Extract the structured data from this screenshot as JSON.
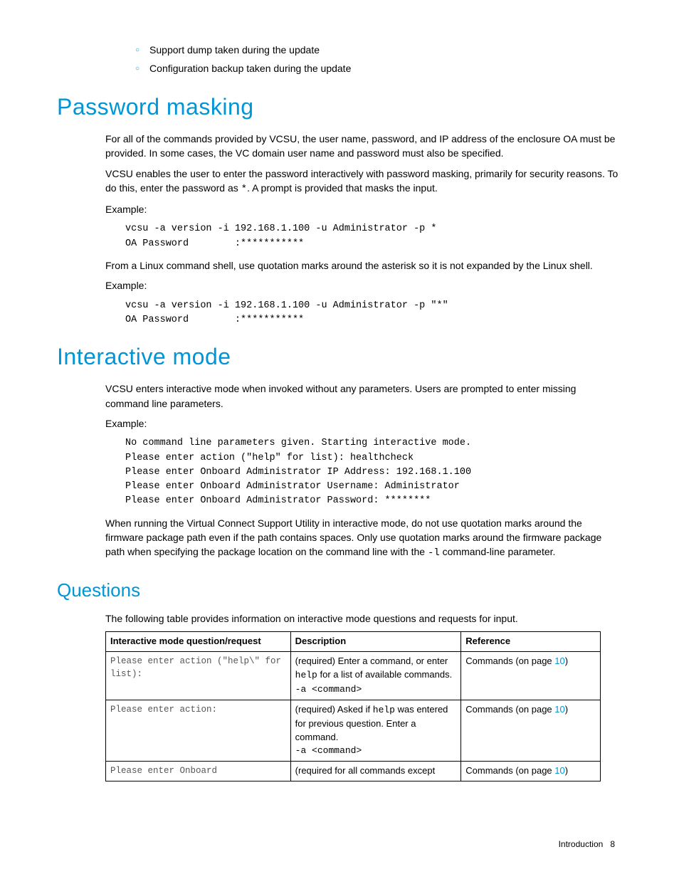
{
  "bullets": {
    "b1": "Support dump taken during the update",
    "b2": "Configuration backup taken during the update"
  },
  "h1a": "Password masking",
  "pm_p1": "For all of the commands provided by VCSU, the user name, password, and IP address of the enclosure OA must be provided. In some cases, the VC domain user name and password must also be specified.",
  "pm_p2a": "VCSU enables the user to enter the password interactively with password masking, primarily for security reasons. To do this, enter the password as ",
  "pm_p2_code": "*",
  "pm_p2b": ". A prompt is provided that masks the input.",
  "example_label": "Example:",
  "code1": "vcsu -a version -i 192.168.1.100 -u Administrator -p *\nOA Password        :***********",
  "pm_p3": "From a Linux command shell, use quotation marks around the asterisk so it is not expanded by the Linux shell.",
  "code2": "vcsu -a version -i 192.168.1.100 -u Administrator -p \"*\"\nOA Password        :***********",
  "h1b": "Interactive mode",
  "im_p1": "VCSU enters interactive mode when invoked without any parameters. Users are prompted to enter missing command line parameters.",
  "code3": "No command line parameters given. Starting interactive mode.\nPlease enter action (\"help\" for list): healthcheck\nPlease enter Onboard Administrator IP Address: 192.168.1.100\nPlease enter Onboard Administrator Username: Administrator\nPlease enter Onboard Administrator Password: ********",
  "im_p2a": "When running the Virtual Connect Support Utility in interactive mode, do not use quotation marks around the firmware package path even if the path contains spaces. Only use quotation marks around the firmware package path when specifying the package location on the command line with the ",
  "im_p2_code": "-l",
  "im_p2b": " command-line parameter.",
  "h2a": "Questions",
  "q_intro": "The following table provides information on interactive mode questions and requests for input.",
  "table": {
    "headers": {
      "c1": "Interactive mode question/request",
      "c2": "Description",
      "c3": "Reference"
    },
    "r1": {
      "q": "Please enter action (\"help\\\" for list):",
      "d_pre": "(required) Enter a command, or enter ",
      "d_code1": "help",
      "d_mid": " for a list of available commands.",
      "d_code2": "-a <command>",
      "ref_pre": "Commands (on page ",
      "ref_num": "10",
      "ref_post": ")"
    },
    "r2": {
      "q": "Please enter action:",
      "d_pre": "(required) Asked if ",
      "d_code1": "help",
      "d_mid": " was entered for previous question. Enter a command.",
      "d_code2": "-a <command>",
      "ref_pre": "Commands (on page ",
      "ref_num": "10",
      "ref_post": ")"
    },
    "r3": {
      "q": "Please enter Onboard",
      "d": "(required for all commands except",
      "ref_pre": "Commands (on page ",
      "ref_num": "10",
      "ref_post": ")"
    }
  },
  "footer": {
    "section": "Introduction",
    "page": "8"
  }
}
